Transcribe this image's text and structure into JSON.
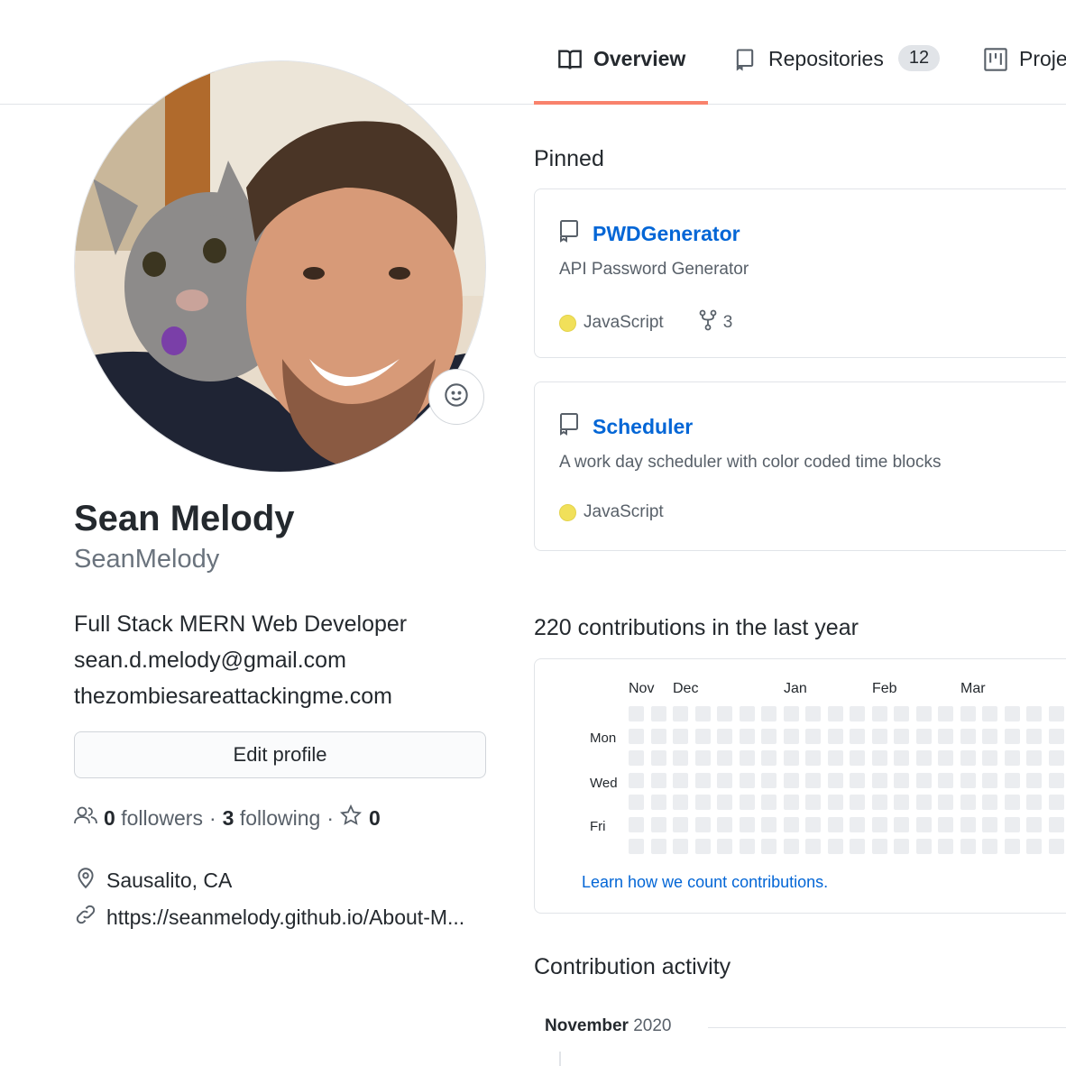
{
  "tabs": [
    {
      "label": "Overview",
      "icon": "book-icon",
      "active": true
    },
    {
      "label": "Repositories",
      "icon": "repo-icon",
      "count": "12"
    },
    {
      "label": "Proje",
      "icon": "project-icon"
    }
  ],
  "profile": {
    "full_name": "Sean Melody",
    "username": "SeanMelody",
    "bio_lines": [
      "Full Stack MERN Web Developer",
      "sean.d.melody@gmail.com",
      "thezombiesareattackingme.com"
    ],
    "edit_label": "Edit profile",
    "followers_count": "0",
    "followers_label": "followers",
    "separator": "·",
    "following_count": "3",
    "following_label": "following",
    "stars_count": "0",
    "location": "Sausalito, CA",
    "website": "https://seanmelody.github.io/About-M..."
  },
  "pinned": {
    "title": "Pinned",
    "repos": [
      {
        "name": "PWDGenerator",
        "description": "API Password Generator",
        "language": "JavaScript",
        "forks": "3"
      },
      {
        "name": "Scheduler",
        "description": "A work day scheduler with color coded time blocks",
        "language": "JavaScript"
      }
    ]
  },
  "contributions": {
    "title": "220 contributions in the last year",
    "months": [
      "Nov",
      "Dec",
      "Jan",
      "Feb",
      "Mar"
    ],
    "days": [
      "Mon",
      "Wed",
      "Fri"
    ],
    "learn_link": "Learn how we count contributions.",
    "empty_color": "#ebedf0"
  },
  "activity": {
    "title": "Contribution activity",
    "month": "November",
    "year": "2020"
  },
  "colors": {
    "link": "#0366d6",
    "tab_underline": "#f9826c",
    "javascript": "#f1e05a"
  }
}
